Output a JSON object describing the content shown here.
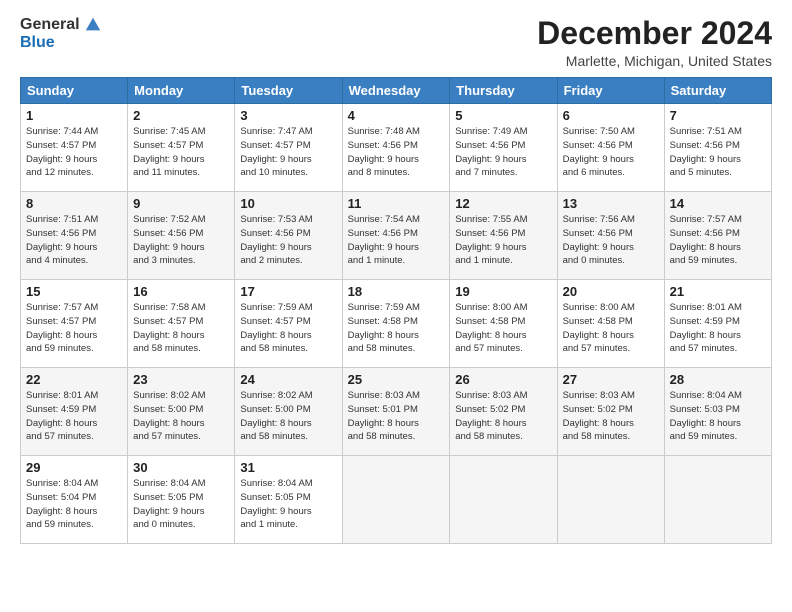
{
  "logo": {
    "general": "General",
    "blue": "Blue"
  },
  "title": "December 2024",
  "location": "Marlette, Michigan, United States",
  "days_of_week": [
    "Sunday",
    "Monday",
    "Tuesday",
    "Wednesday",
    "Thursday",
    "Friday",
    "Saturday"
  ],
  "weeks": [
    [
      {
        "day": "1",
        "info": "Sunrise: 7:44 AM\nSunset: 4:57 PM\nDaylight: 9 hours\nand 12 minutes."
      },
      {
        "day": "2",
        "info": "Sunrise: 7:45 AM\nSunset: 4:57 PM\nDaylight: 9 hours\nand 11 minutes."
      },
      {
        "day": "3",
        "info": "Sunrise: 7:47 AM\nSunset: 4:57 PM\nDaylight: 9 hours\nand 10 minutes."
      },
      {
        "day": "4",
        "info": "Sunrise: 7:48 AM\nSunset: 4:56 PM\nDaylight: 9 hours\nand 8 minutes."
      },
      {
        "day": "5",
        "info": "Sunrise: 7:49 AM\nSunset: 4:56 PM\nDaylight: 9 hours\nand 7 minutes."
      },
      {
        "day": "6",
        "info": "Sunrise: 7:50 AM\nSunset: 4:56 PM\nDaylight: 9 hours\nand 6 minutes."
      },
      {
        "day": "7",
        "info": "Sunrise: 7:51 AM\nSunset: 4:56 PM\nDaylight: 9 hours\nand 5 minutes."
      }
    ],
    [
      {
        "day": "8",
        "info": "Sunrise: 7:51 AM\nSunset: 4:56 PM\nDaylight: 9 hours\nand 4 minutes."
      },
      {
        "day": "9",
        "info": "Sunrise: 7:52 AM\nSunset: 4:56 PM\nDaylight: 9 hours\nand 3 minutes."
      },
      {
        "day": "10",
        "info": "Sunrise: 7:53 AM\nSunset: 4:56 PM\nDaylight: 9 hours\nand 2 minutes."
      },
      {
        "day": "11",
        "info": "Sunrise: 7:54 AM\nSunset: 4:56 PM\nDaylight: 9 hours\nand 1 minute."
      },
      {
        "day": "12",
        "info": "Sunrise: 7:55 AM\nSunset: 4:56 PM\nDaylight: 9 hours\nand 1 minute."
      },
      {
        "day": "13",
        "info": "Sunrise: 7:56 AM\nSunset: 4:56 PM\nDaylight: 9 hours\nand 0 minutes."
      },
      {
        "day": "14",
        "info": "Sunrise: 7:57 AM\nSunset: 4:56 PM\nDaylight: 8 hours\nand 59 minutes."
      }
    ],
    [
      {
        "day": "15",
        "info": "Sunrise: 7:57 AM\nSunset: 4:57 PM\nDaylight: 8 hours\nand 59 minutes."
      },
      {
        "day": "16",
        "info": "Sunrise: 7:58 AM\nSunset: 4:57 PM\nDaylight: 8 hours\nand 58 minutes."
      },
      {
        "day": "17",
        "info": "Sunrise: 7:59 AM\nSunset: 4:57 PM\nDaylight: 8 hours\nand 58 minutes."
      },
      {
        "day": "18",
        "info": "Sunrise: 7:59 AM\nSunset: 4:58 PM\nDaylight: 8 hours\nand 58 minutes."
      },
      {
        "day": "19",
        "info": "Sunrise: 8:00 AM\nSunset: 4:58 PM\nDaylight: 8 hours\nand 57 minutes."
      },
      {
        "day": "20",
        "info": "Sunrise: 8:00 AM\nSunset: 4:58 PM\nDaylight: 8 hours\nand 57 minutes."
      },
      {
        "day": "21",
        "info": "Sunrise: 8:01 AM\nSunset: 4:59 PM\nDaylight: 8 hours\nand 57 minutes."
      }
    ],
    [
      {
        "day": "22",
        "info": "Sunrise: 8:01 AM\nSunset: 4:59 PM\nDaylight: 8 hours\nand 57 minutes."
      },
      {
        "day": "23",
        "info": "Sunrise: 8:02 AM\nSunset: 5:00 PM\nDaylight: 8 hours\nand 57 minutes."
      },
      {
        "day": "24",
        "info": "Sunrise: 8:02 AM\nSunset: 5:00 PM\nDaylight: 8 hours\nand 58 minutes."
      },
      {
        "day": "25",
        "info": "Sunrise: 8:03 AM\nSunset: 5:01 PM\nDaylight: 8 hours\nand 58 minutes."
      },
      {
        "day": "26",
        "info": "Sunrise: 8:03 AM\nSunset: 5:02 PM\nDaylight: 8 hours\nand 58 minutes."
      },
      {
        "day": "27",
        "info": "Sunrise: 8:03 AM\nSunset: 5:02 PM\nDaylight: 8 hours\nand 58 minutes."
      },
      {
        "day": "28",
        "info": "Sunrise: 8:04 AM\nSunset: 5:03 PM\nDaylight: 8 hours\nand 59 minutes."
      }
    ],
    [
      {
        "day": "29",
        "info": "Sunrise: 8:04 AM\nSunset: 5:04 PM\nDaylight: 8 hours\nand 59 minutes."
      },
      {
        "day": "30",
        "info": "Sunrise: 8:04 AM\nSunset: 5:05 PM\nDaylight: 9 hours\nand 0 minutes."
      },
      {
        "day": "31",
        "info": "Sunrise: 8:04 AM\nSunset: 5:05 PM\nDaylight: 9 hours\nand 1 minute."
      },
      {
        "day": "",
        "info": ""
      },
      {
        "day": "",
        "info": ""
      },
      {
        "day": "",
        "info": ""
      },
      {
        "day": "",
        "info": ""
      }
    ]
  ]
}
